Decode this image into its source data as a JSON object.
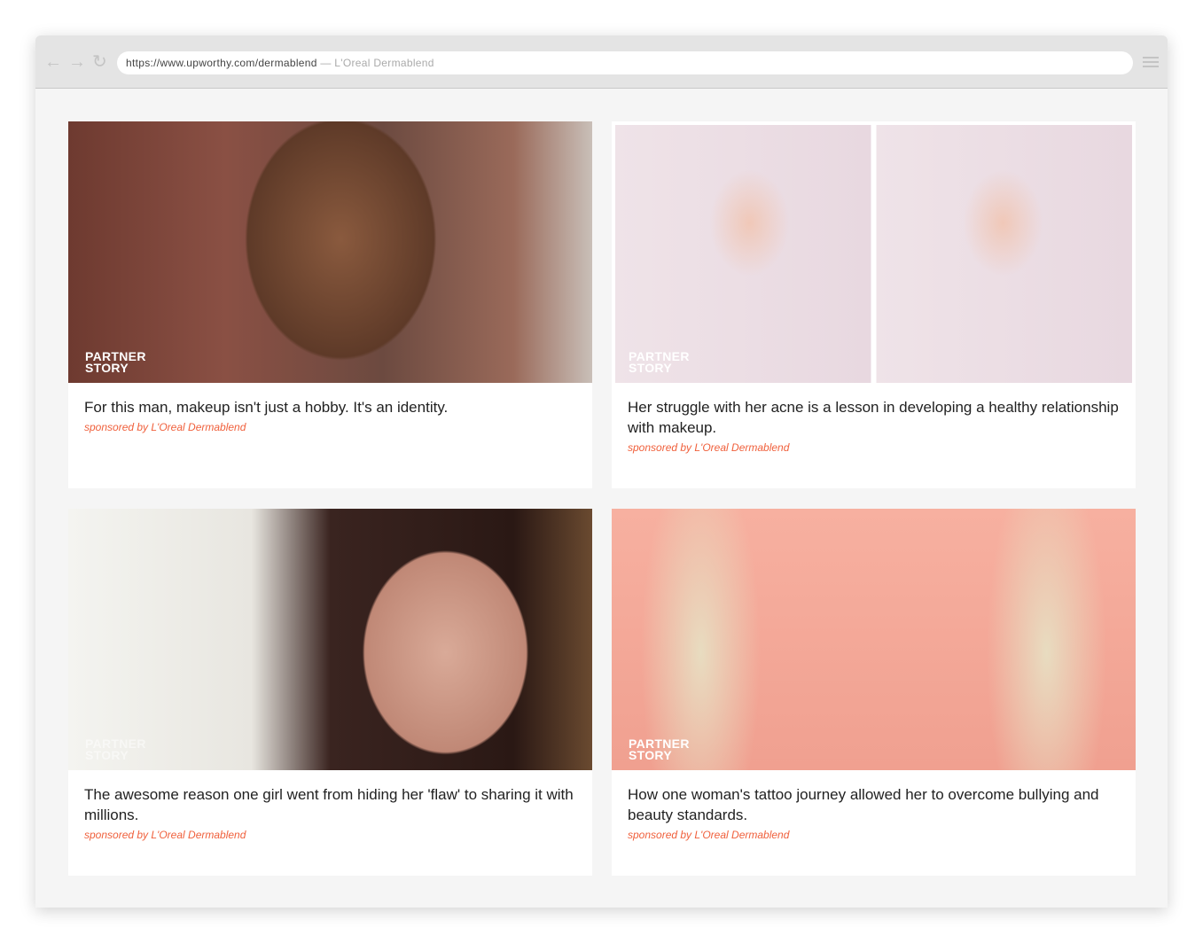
{
  "browser": {
    "url": "https://www.upworthy.com/dermablend",
    "page_title": "L'Oreal Dermablend",
    "separator": "—",
    "back_icon": "←",
    "forward_icon": "→",
    "reload_icon": "↻"
  },
  "cards": [
    {
      "badge_line1": "PARTNER",
      "badge_line2": "STORY",
      "title": "For this man, makeup isn't just a hobby. It's an identity.",
      "sponsor": "sponsored by L'Oreal Dermablend"
    },
    {
      "badge_line1": "PARTNER",
      "badge_line2": "STORY",
      "title": "Her struggle with her acne is a lesson in developing a healthy relationship with makeup.",
      "sponsor": "sponsored by L'Oreal Dermablend"
    },
    {
      "badge_line1": "PARTNER",
      "badge_line2": "STORY",
      "title": "The awesome reason one girl went from hiding her 'flaw' to sharing it with millions.",
      "sponsor": "sponsored by L'Oreal Dermablend"
    },
    {
      "badge_line1": "PARTNER",
      "badge_line2": "STORY",
      "title": "How one woman's tattoo journey allowed her to overcome bullying and beauty standards.",
      "sponsor": "sponsored by L'Oreal Dermablend"
    }
  ],
  "colors": {
    "sponsor": "#f0603c"
  }
}
